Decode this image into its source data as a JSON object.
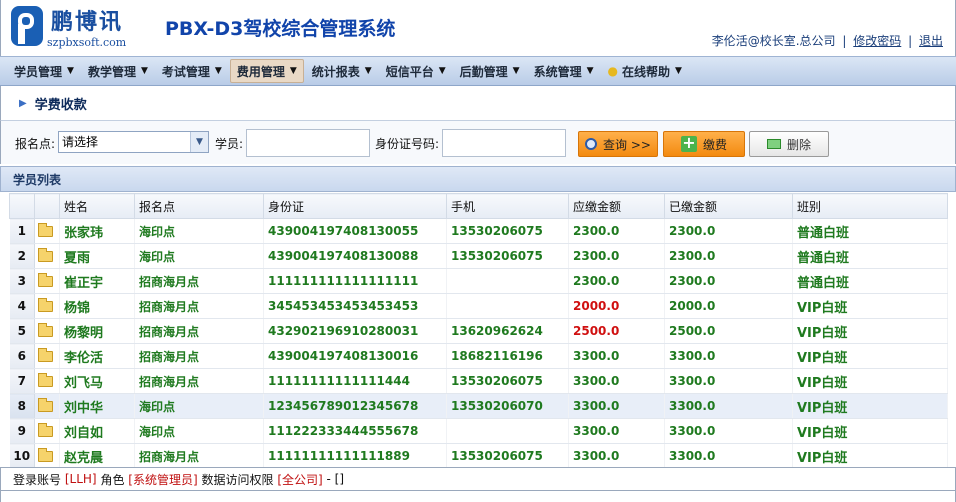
{
  "app": {
    "logo_cn": "鹏博讯",
    "logo_en": "szpbxsoft.com",
    "title": "PBX-D3驾校综合管理系统"
  },
  "user_bar": {
    "user": "李伦活@校长室.总公司",
    "change_password": "修改密码",
    "logout": "退出",
    "separator": "|"
  },
  "menu": [
    {
      "label": "学员管理",
      "icon": "caret-down-icon"
    },
    {
      "label": "教学管理",
      "icon": "caret-down-icon"
    },
    {
      "label": "考试管理",
      "icon": "caret-down-icon"
    },
    {
      "label": "费用管理",
      "icon": "caret-down-icon",
      "active": true
    },
    {
      "label": "统计报表",
      "icon": "caret-down-icon"
    },
    {
      "label": "短信平台",
      "icon": "caret-down-icon"
    },
    {
      "label": "后勤管理",
      "icon": "caret-down-icon"
    },
    {
      "label": "系统管理",
      "icon": "caret-down-icon"
    },
    {
      "label": "在线帮助",
      "icon": "caret-down-icon",
      "prefix_icon": "lightbulb-icon"
    }
  ],
  "page": {
    "title": "学费收款"
  },
  "filter": {
    "site_label": "报名点:",
    "site_value": "请选择",
    "student_label": "学员:",
    "student_value": "",
    "id_label": "身份证号码:",
    "id_value": "",
    "query_label": "查询 >>",
    "pay_label": "缴费",
    "delete_label": "删除"
  },
  "list": {
    "title": "学员列表",
    "columns": [
      "姓名",
      "报名点",
      "身份证",
      "手机",
      "应缴金额",
      "已缴金额",
      "班别"
    ],
    "rows": [
      {
        "no": "1",
        "name": "张家玮",
        "site": "海印点",
        "id": "439004197408130055",
        "phone": "13530206075",
        "due": "2300.0",
        "due_red": false,
        "paid": "2300.0",
        "cls": "普通白班"
      },
      {
        "no": "2",
        "name": "夏雨",
        "site": "海印点",
        "id": "439004197408130088",
        "phone": "13530206075",
        "due": "2300.0",
        "due_red": false,
        "paid": "2300.0",
        "cls": "普通白班"
      },
      {
        "no": "3",
        "name": "崔正宇",
        "site": "招商海月点",
        "id": "111111111111111111",
        "phone": "",
        "due": "2300.0",
        "due_red": false,
        "paid": "2300.0",
        "cls": "普通白班"
      },
      {
        "no": "4",
        "name": "杨锦",
        "site": "招商海月点",
        "id": "345453453453453453",
        "phone": "",
        "due": "2000.0",
        "due_red": true,
        "paid": "2000.0",
        "cls": "VIP白班"
      },
      {
        "no": "5",
        "name": "杨黎明",
        "site": "招商海月点",
        "id": "432902196910280031",
        "phone": "13620962624",
        "due": "2500.0",
        "due_red": true,
        "paid": "2500.0",
        "cls": "VIP白班"
      },
      {
        "no": "6",
        "name": "李伦活",
        "site": "招商海月点",
        "id": "439004197408130016",
        "phone": "18682116196",
        "due": "3300.0",
        "due_red": false,
        "paid": "3300.0",
        "cls": "VIP白班"
      },
      {
        "no": "7",
        "name": "刘飞马",
        "site": "招商海月点",
        "id": "11111111111111444",
        "phone": "13530206075",
        "due": "3300.0",
        "due_red": false,
        "paid": "3300.0",
        "cls": "VIP白班"
      },
      {
        "no": "8",
        "name": "刘中华",
        "site": "海印点",
        "id": "123456789012345678",
        "phone": "13530206070",
        "due": "3300.0",
        "due_red": false,
        "paid": "3300.0",
        "cls": "VIP白班",
        "highlight": true
      },
      {
        "no": "9",
        "name": "刘自如",
        "site": "海印点",
        "id": "111222333444555678",
        "phone": "",
        "due": "3300.0",
        "due_red": false,
        "paid": "3300.0",
        "cls": "VIP白班"
      },
      {
        "no": "10",
        "name": "赵克晨",
        "site": "招商海月点",
        "id": "11111111111111889",
        "phone": "13530206075",
        "due": "3300.0",
        "due_red": false,
        "paid": "3300.0",
        "cls": "VIP白班"
      }
    ]
  },
  "status": {
    "account_label": "登录账号",
    "account": "[LLH]",
    "role_label": "角色",
    "role": "[系统管理员]",
    "scope_label": "数据访问权限",
    "scope": "[全公司]",
    "tail": "- []"
  },
  "colors": {
    "brand_blue": "#1144aa",
    "value_green": "#1f7a1f",
    "value_red": "#d01010",
    "accent_orange": "#f38a10"
  }
}
